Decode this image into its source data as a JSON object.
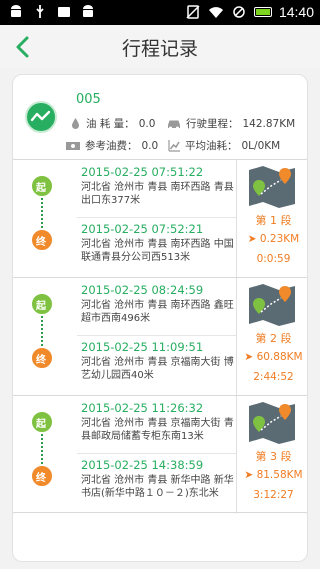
{
  "status_bar": {
    "time": "14:40"
  },
  "header": {
    "title": "行程记录"
  },
  "summary": {
    "car_no": "005",
    "fuel_label": "油 耗 量：",
    "fuel_value": "0.0",
    "mileage_label": "行驶里程：",
    "mileage_value": "142.87KM",
    "cost_label": "参考油费：",
    "cost_value": "0.0",
    "avg_label": "平均油耗：",
    "avg_value": "0L/0KM"
  },
  "trips": [
    {
      "start_badge": "起",
      "end_badge": "终",
      "start_time": "2015-02-25 07:51:22",
      "start_addr": "河北省 沧州市 青县 南环西路 青县出口东377米",
      "end_time": "2015-02-25 07:52:21",
      "end_addr": "河北省 沧州市 青县 南环西路 中国联通青县分公司西513米",
      "segment": "第 1 段",
      "distance": "0.23KM",
      "duration": "0:0:59"
    },
    {
      "start_badge": "起",
      "end_badge": "终",
      "start_time": "2015-02-25 08:24:59",
      "start_addr": "河北省 沧州市 青县 南环西路 鑫旺超市西南496米",
      "end_time": "2015-02-25 11:09:51",
      "end_addr": "河北省 沧州市 青县 京福南大街 博艺幼儿园西40米",
      "segment": "第 2 段",
      "distance": "60.88KM",
      "duration": "2:44:52"
    },
    {
      "start_badge": "起",
      "end_badge": "终",
      "start_time": "2015-02-25 11:26:32",
      "start_addr": "河北省 沧州市 青县 京福南大街 青县邮政局储蓄专柜东南13米",
      "end_time": "2015-02-25 14:38:59",
      "end_addr": "河北省 沧州市 青县 新华中路 新华书店(新华中路１０－２)东北米",
      "segment": "第 3 段",
      "distance": "81.58KM",
      "duration": "3:12:27"
    }
  ],
  "colors": {
    "accent_green": "#27ae60",
    "accent_orange": "#f07c22"
  }
}
